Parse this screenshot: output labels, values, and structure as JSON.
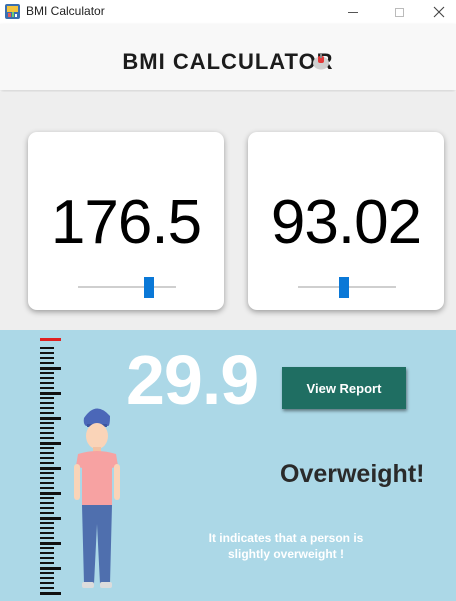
{
  "window": {
    "title": "BMI Calculator"
  },
  "header": {
    "title": "BMI CALCULATOR"
  },
  "inputs": {
    "height": {
      "value": "176.5",
      "slider_position": 0.75
    },
    "weight": {
      "value": "93.02",
      "slider_position": 0.47
    }
  },
  "result": {
    "bmi": "29.9",
    "report_button": "View Report",
    "status": "Overweight!",
    "description": "It indicates that a person is slightly overweight !"
  },
  "colors": {
    "accent": "#0a78d7",
    "result_bg": "#acd8e7",
    "button_bg": "#1f6e62",
    "ruler_marker": "#e02020"
  },
  "icons": {
    "app": "bmi-app-icon",
    "cursor": "cursor-icon",
    "ruler": "height-ruler-icon",
    "person": "person-illustration"
  }
}
